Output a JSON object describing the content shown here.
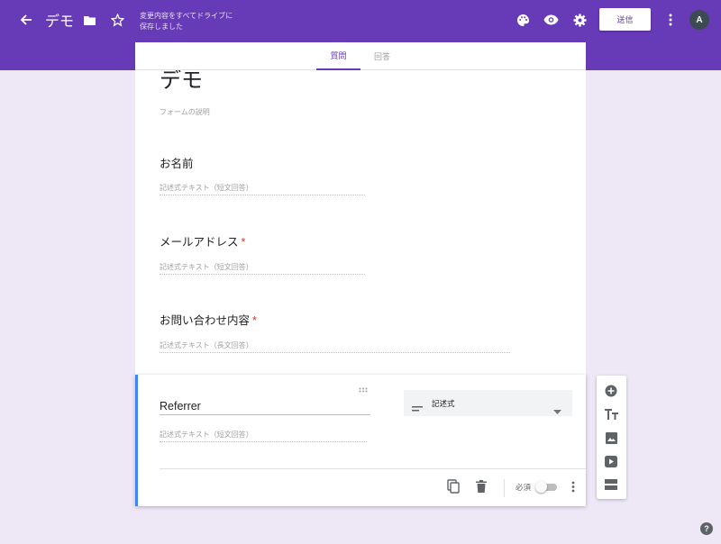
{
  "header": {
    "title": "デモ",
    "save_status": "変更内容をすべてドライブに保存しました",
    "send_label": "送信",
    "avatar_initial": "A",
    "icons": [
      "arrow-back-icon",
      "folder-icon",
      "star-icon",
      "palette-icon",
      "eye-icon",
      "gear-icon",
      "more-vert-icon"
    ]
  },
  "tabs": [
    {
      "label": "質問",
      "active": true
    },
    {
      "label": "回答",
      "active": false
    }
  ],
  "form": {
    "title": "デモ",
    "description_placeholder": "フォームの説明",
    "questions": [
      {
        "title": "お名前",
        "required": false,
        "answer_placeholder": "記述式テキスト（短文回答）"
      },
      {
        "title": "メールアドレス",
        "required": true,
        "answer_placeholder": "記述式テキスト（短文回答）"
      },
      {
        "title": "お問い合わせ内容",
        "required": true,
        "answer_placeholder": "記述式テキスト（長文回答）"
      }
    ],
    "required_mark": "*"
  },
  "active_question": {
    "title": "Referrer",
    "type_label": "記述式",
    "answer_placeholder": "記述式テキスト（短文回答）",
    "required_label": "必須",
    "required_on": false
  },
  "side_toolbar": {
    "icons": [
      "add-question-icon",
      "title-icon",
      "image-icon",
      "video-icon",
      "section-icon"
    ]
  },
  "help_label": "?",
  "colors": {
    "accent": "#673ab7",
    "background": "#ede7f6",
    "required": "#d93025",
    "focus_border": "#4285f4"
  }
}
